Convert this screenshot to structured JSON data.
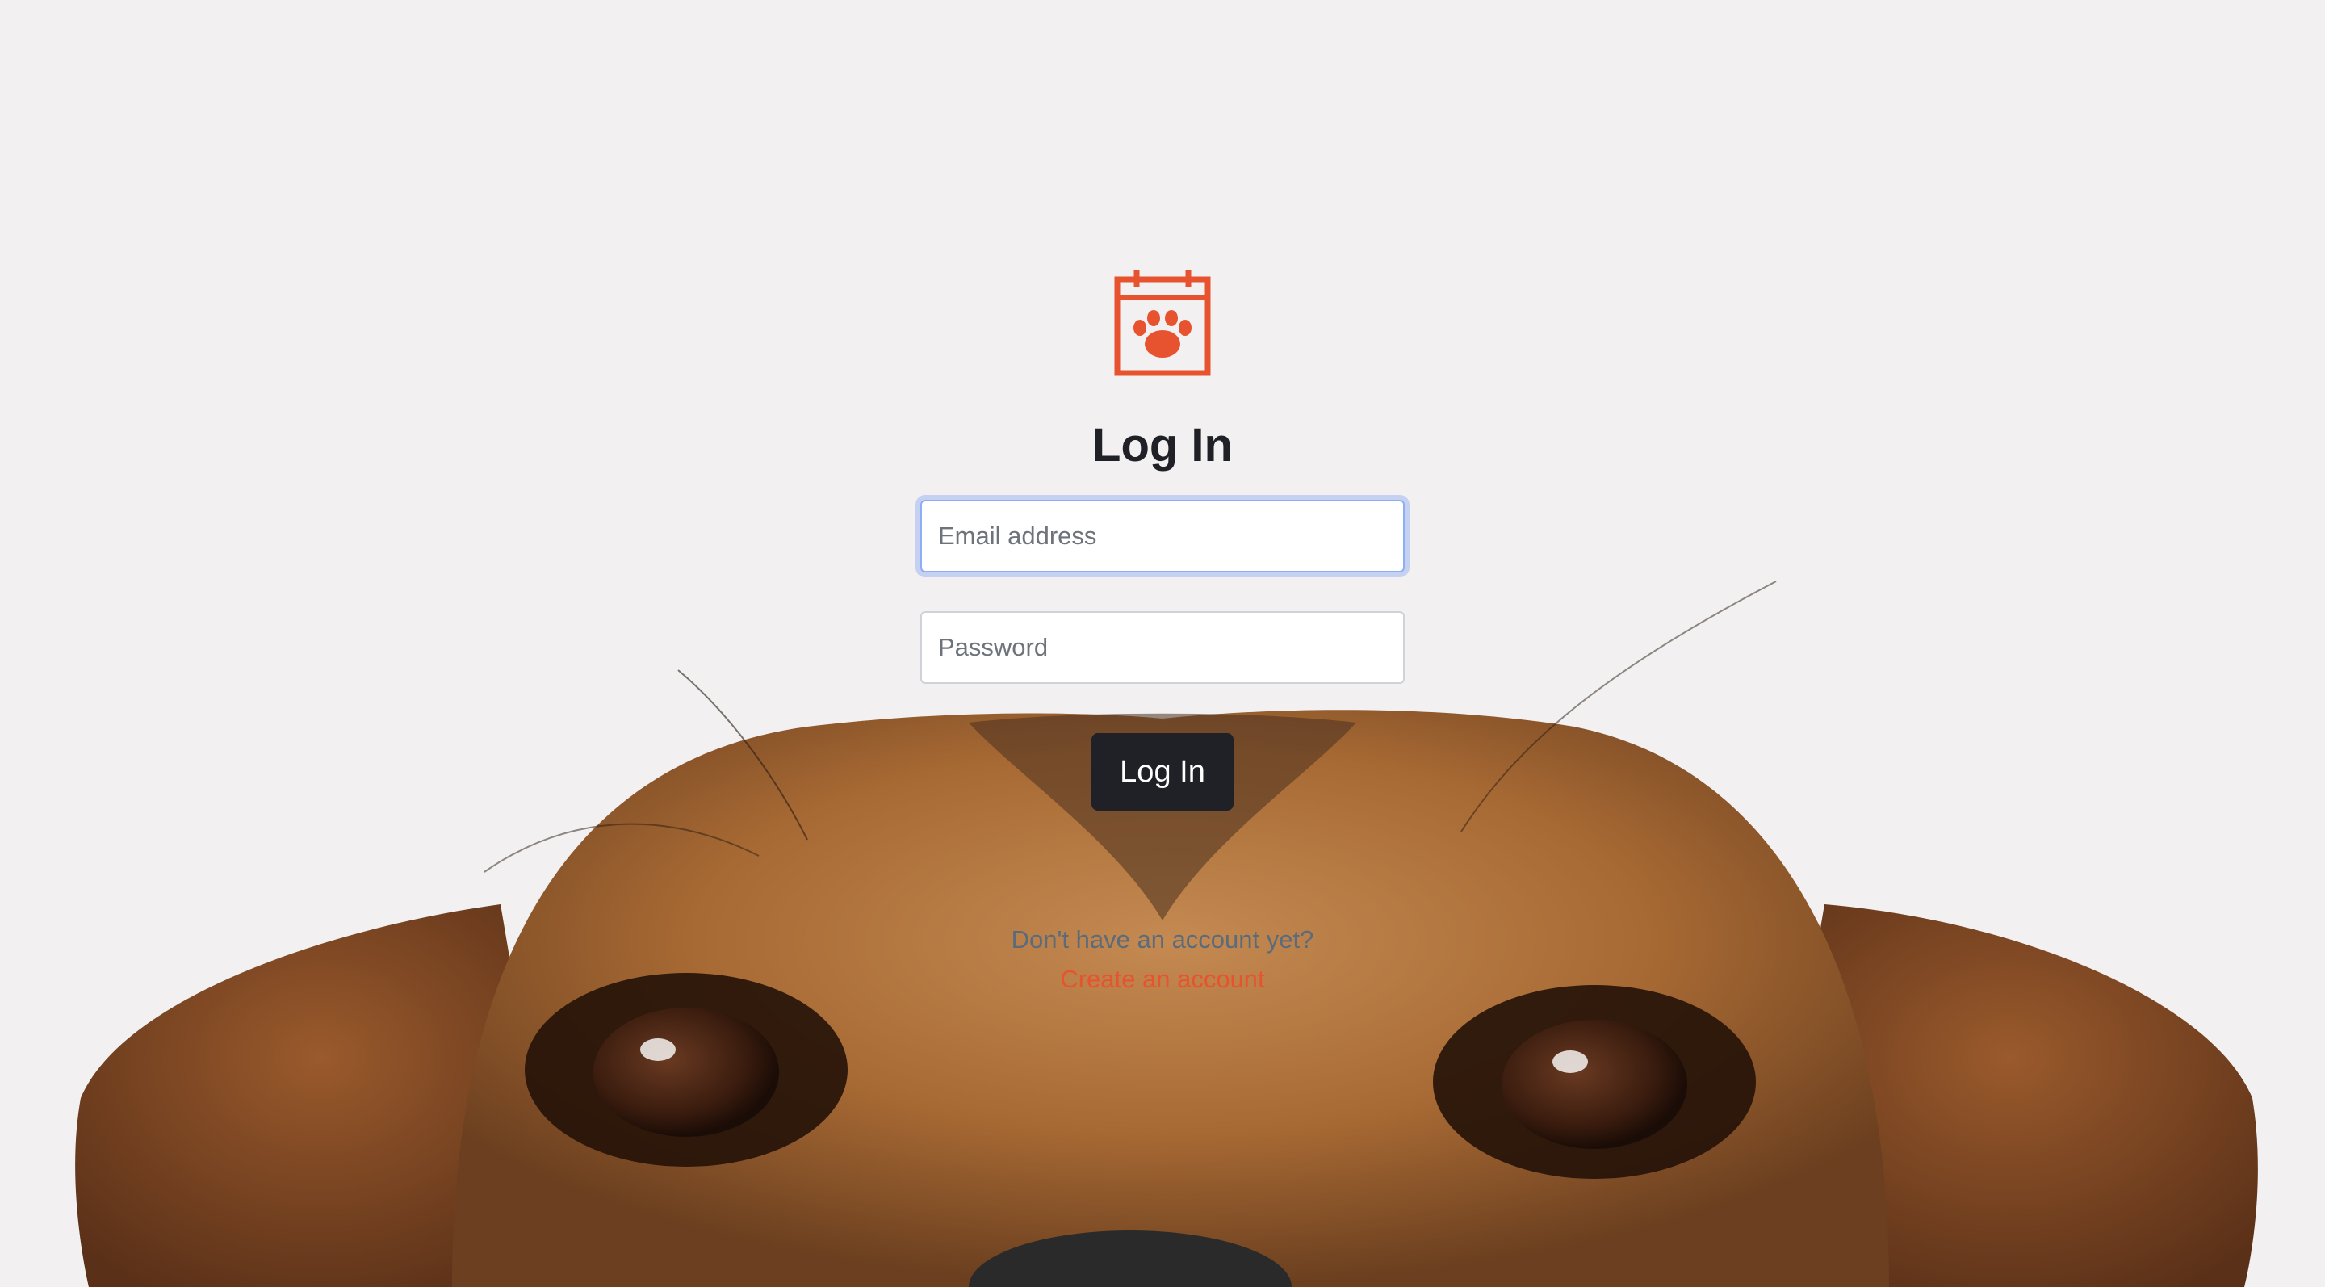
{
  "page": {
    "title": "Log In",
    "brand_color": "#e8532f",
    "background": "photo-of-dog-peeking-from-bottom"
  },
  "logo": {
    "icon": "calendar-paw-icon",
    "color": "#e8532f"
  },
  "form": {
    "email_placeholder": "Email address",
    "email_value": "",
    "password_placeholder": "Password",
    "password_value": "",
    "submit_label": "Log In"
  },
  "signup": {
    "prompt": "Don't have an account yet?",
    "link_label": "Create an account"
  }
}
